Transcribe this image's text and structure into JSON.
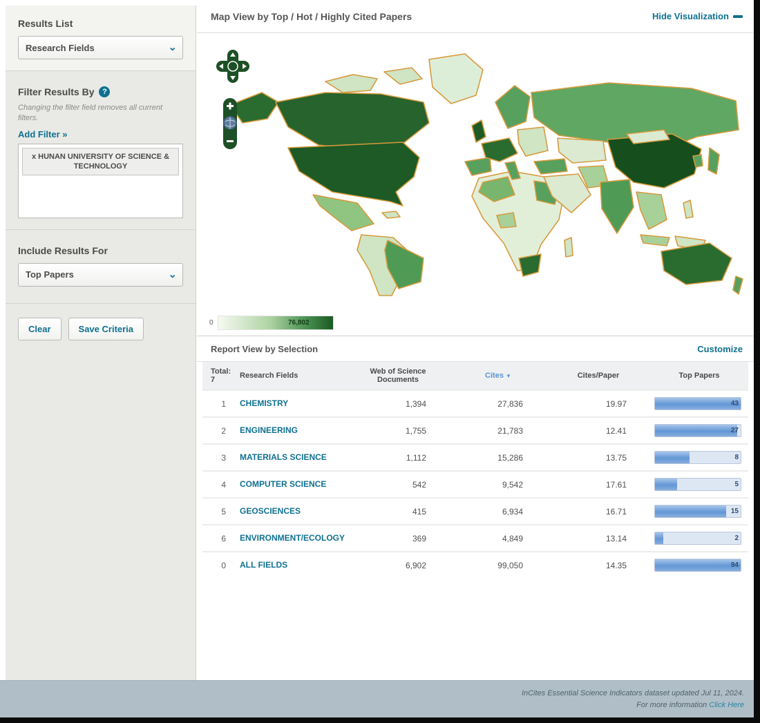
{
  "colors": {
    "accent_teal": "#0f7190",
    "sidebar_bg": "#e9e9e6",
    "footer_bg": "#b0bfc7",
    "map_border": "#d79a3d",
    "map_green_darkest": "#164f1d",
    "map_green_dark": "#2a6b2f",
    "map_green_medium": "#4f9b55",
    "map_green_light": "#a8d19a",
    "map_green_pale": "#e2efd8",
    "bar_blue": "#6397d6"
  },
  "sidebar": {
    "results_list": {
      "label": "Results List",
      "selected": "Research Fields"
    },
    "filter": {
      "title": "Filter Results By",
      "help_icon": "question-mark",
      "note": "Changing the filter field removes all current filters.",
      "add_filter_label": "Add Filter »",
      "active_filter_remove_symbol": "x",
      "active_filter": "HUNAN UNIVERSITY OF SCIENCE & TECHNOLOGY"
    },
    "include_results_for": {
      "label": "Include Results For",
      "selected": "Top Papers"
    },
    "buttons": {
      "clear": "Clear",
      "save": "Save Criteria"
    }
  },
  "map_panel": {
    "title": "Map View by Top / Hot / Highly Cited Papers",
    "hide_link": "Hide Visualization",
    "legend": {
      "min": "0",
      "max": "76,802"
    },
    "controls": [
      "pan-compass",
      "zoom-in",
      "globe-reset",
      "zoom-out"
    ]
  },
  "report": {
    "title": "Report View by Selection",
    "customize_link": "Customize",
    "total_label": "Total:",
    "total_value": "7",
    "columns": {
      "field": "Research Fields",
      "docs": "Web of Science Documents",
      "cites": "Cites",
      "cites_sort_arrow": "▼",
      "cpp": "Cites/Paper",
      "top": "Top Papers"
    },
    "rows": [
      {
        "rank": "1",
        "field": "CHEMISTRY",
        "docs": "1,394",
        "cites": "27,836",
        "cpp": "19.97",
        "top_papers": "43",
        "bar_pct": 100
      },
      {
        "rank": "2",
        "field": "ENGINEERING",
        "docs": "1,755",
        "cites": "21,783",
        "cpp": "12.41",
        "top_papers": "27",
        "bar_pct": 96
      },
      {
        "rank": "3",
        "field": "MATERIALS SCIENCE",
        "docs": "1,112",
        "cites": "15,286",
        "cpp": "13.75",
        "top_papers": "8",
        "bar_pct": 40
      },
      {
        "rank": "4",
        "field": "COMPUTER SCIENCE",
        "docs": "542",
        "cites": "9,542",
        "cpp": "17.61",
        "top_papers": "5",
        "bar_pct": 26
      },
      {
        "rank": "5",
        "field": "GEOSCIENCES",
        "docs": "415",
        "cites": "6,934",
        "cpp": "16.71",
        "top_papers": "15",
        "bar_pct": 83
      },
      {
        "rank": "6",
        "field": "ENVIRONMENT/ECOLOGY",
        "docs": "369",
        "cites": "4,849",
        "cpp": "13.14",
        "top_papers": "2",
        "bar_pct": 10
      },
      {
        "rank": "0",
        "field": "ALL FIELDS",
        "docs": "6,902",
        "cites": "99,050",
        "cpp": "14.35",
        "top_papers": "94",
        "bar_pct": 100
      }
    ]
  },
  "footer": {
    "line1": "InCites Essential Science Indicators dataset updated Jul 11, 2024.",
    "line2_prefix": "For more information",
    "line2_link": "Click Here"
  }
}
